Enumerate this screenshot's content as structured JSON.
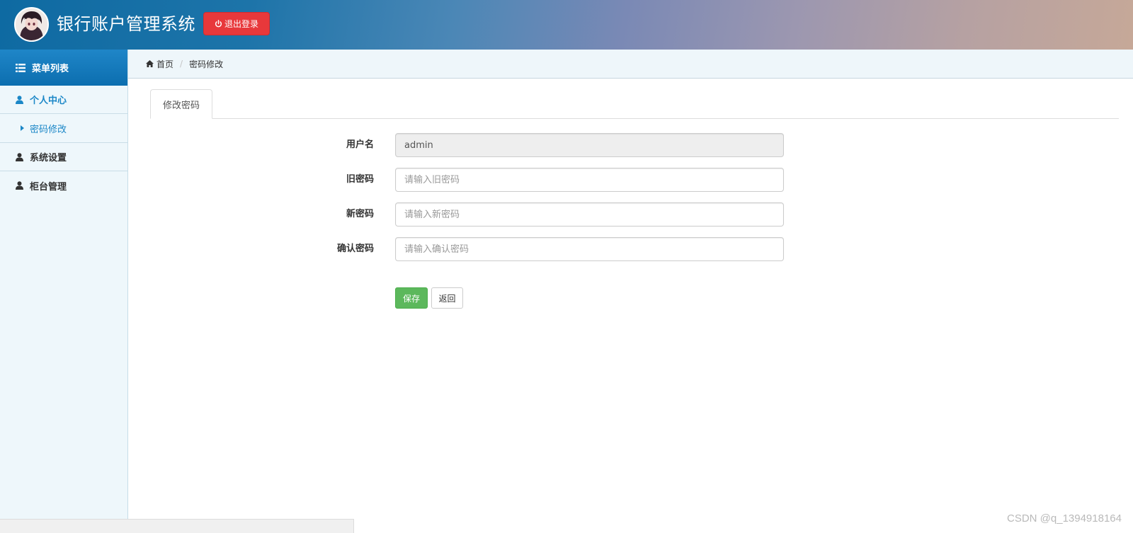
{
  "header": {
    "title": "银行账户管理系统",
    "logout_label": "退出登录"
  },
  "sidebar": {
    "heading": "菜单列表",
    "items": [
      {
        "label": "个人中心",
        "active": true,
        "icon": "user-icon"
      },
      {
        "label": "密码修改",
        "sub": true,
        "icon": "caret-right-icon"
      },
      {
        "label": "系统设置",
        "icon": "user-icon"
      },
      {
        "label": "柜台管理",
        "icon": "user-icon"
      }
    ]
  },
  "breadcrumb": {
    "home": "首页",
    "current": "密码修改"
  },
  "tabs": [
    {
      "label": "修改密码",
      "active": true
    }
  ],
  "form": {
    "username": {
      "label": "用户名",
      "value": "admin"
    },
    "old_password": {
      "label": "旧密码",
      "placeholder": "请输入旧密码"
    },
    "new_password": {
      "label": "新密码",
      "placeholder": "请输入新密码"
    },
    "confirm_password": {
      "label": "确认密码",
      "placeholder": "请输入确认密码"
    },
    "save_label": "保存",
    "back_label": "返回"
  },
  "watermark": "CSDN @q_1394918164",
  "colors": {
    "primary_blue": "#1b87c7",
    "logout_red": "#e8383b",
    "save_green": "#5cb85c",
    "sidebar_bg": "#eef7fb"
  }
}
